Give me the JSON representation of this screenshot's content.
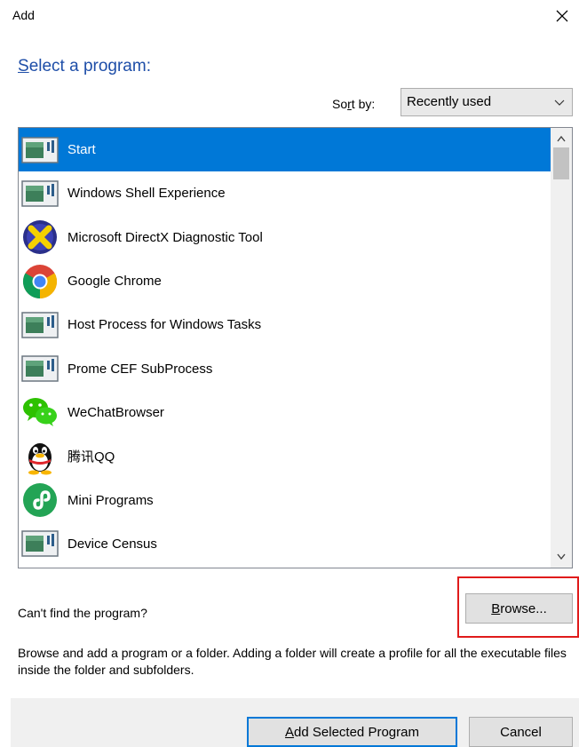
{
  "window": {
    "title": "Add",
    "close_glyph": "✕"
  },
  "heading": {
    "mnemonic": "S",
    "rest": "elect a program:"
  },
  "sort": {
    "label_pre": "So",
    "label_mnemonic": "r",
    "label_post": "t by:",
    "selected": "Recently used",
    "chevron": "⌵"
  },
  "programs": [
    {
      "name": "Start",
      "icon": "generic-app-icon",
      "selected": true
    },
    {
      "name": "Windows Shell Experience",
      "icon": "generic-app-icon"
    },
    {
      "name": "Microsoft DirectX Diagnostic Tool",
      "icon": "directx-icon"
    },
    {
      "name": "Google Chrome",
      "icon": "chrome-icon"
    },
    {
      "name": "Host Process for Windows Tasks",
      "icon": "generic-app-icon"
    },
    {
      "name": "Prome CEF SubProcess",
      "icon": "generic-app-icon"
    },
    {
      "name": "WeChatBrowser",
      "icon": "wechat-icon"
    },
    {
      "name": "腾讯QQ",
      "icon": "qq-penguin-icon"
    },
    {
      "name": "Mini Programs",
      "icon": "mini-programs-icon"
    },
    {
      "name": "Device Census",
      "icon": "generic-app-icon"
    }
  ],
  "scroll": {
    "up": "▲",
    "down": "▼"
  },
  "cant_find": "Can't find the program?",
  "browse": {
    "mnemonic": "B",
    "rest": "rowse..."
  },
  "description": "Browse and add a program or a folder. Adding a folder will create a profile for all the executable files inside the folder and subfolders.",
  "buttons": {
    "add": {
      "mnemonic": "A",
      "rest": "dd Selected Program"
    },
    "cancel": "Cancel"
  },
  "colors": {
    "accent": "#0078d7",
    "heading": "#1e4ea8",
    "highlight": "#e01b1b"
  }
}
